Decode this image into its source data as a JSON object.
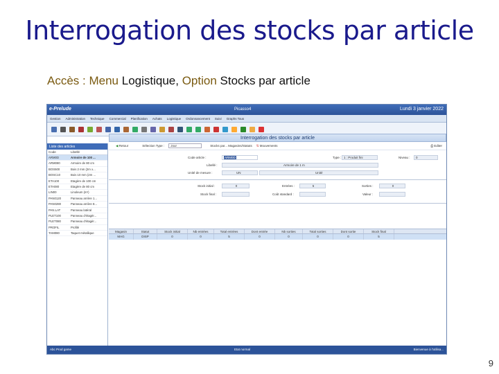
{
  "slide": {
    "title": "Interrogation des stocks par article",
    "sub_k1": "Accès : Menu",
    "sub_v1": "Logistique,",
    "sub_k2": "Option",
    "sub_v2": "Stocks par article",
    "page_number": "9"
  },
  "app": {
    "brand": "e-Prelude",
    "company": "Picasso4",
    "date": "Lundi 3 janvier 2022",
    "menu": [
      "Gestion",
      "Administration",
      "Technique",
      "Commercial",
      "Planification",
      "Achats",
      "Logistique",
      "Ordonnancement",
      "Suivi",
      "Graphs Tous"
    ],
    "toolbar_icons": [
      "disk-icon",
      "print-icon",
      "folder-icon",
      "book-icon",
      "tool-icon",
      "grid-icon",
      "grid-icon",
      "chart-icon",
      "chart-icon",
      "chart-icon",
      "table-icon",
      "grid-icon",
      "envelope-icon",
      "scissors-icon",
      "tools-icon",
      "cart-icon",
      "cart-icon",
      "arrow-icon",
      "stop-icon",
      "refresh-icon",
      "star-icon",
      "gear-icon",
      "warning-icon",
      "delete-icon"
    ],
    "sidebar": {
      "title": "Liste des articles",
      "col1": "Code",
      "col2": "Libellé",
      "rows": [
        {
          "code": "ARM0D",
          "label": "Armoire de 100 ..."
        },
        {
          "code": "ARM080",
          "label": "Armoire de 80 cm"
        },
        {
          "code": "BOS500",
          "label": "Bois 2 mm (2m x..."
        },
        {
          "code": "BOSC10",
          "label": "Bois 10 mm (2m ..."
        },
        {
          "code": "ETA100",
          "label": "Etagère de 100 cm"
        },
        {
          "code": "ETA080",
          "label": "Etagère de 80 cm"
        },
        {
          "code": "LIN00",
          "label": "Linoleum (m²)"
        },
        {
          "code": "PAN0120",
          "label": "Panneau arrière 1..."
        },
        {
          "code": "PAN0280",
          "label": "Panneau arrière 8..."
        },
        {
          "code": "PAN.LAT",
          "label": "Panneau latéral"
        },
        {
          "code": "PLET100",
          "label": "Panneau d'étagèr..."
        },
        {
          "code": "PLET080",
          "label": "Panneau d'étagèr..."
        },
        {
          "code": "PROFIL",
          "label": "Profilé"
        },
        {
          "code": "TAM080",
          "label": "Taquet métallique"
        }
      ]
    },
    "form": {
      "title": "Interrogation des stocks par article",
      "back_label": "Retour",
      "selection_label": "Sélection Type :",
      "selection_value": "Jour",
      "stocks_menu_label": "Stocks par... Magasins/Statuts",
      "movements_label": "Mouvements",
      "edit_label": "Editer",
      "code_label": "Code article :",
      "code_value": "ARM0D",
      "type_label": "Type :",
      "type_value": "1 : Produit fini",
      "niveau_label": "Niveau :",
      "niveau_value": "0",
      "libelle_label": "Libellé :",
      "libelle_value": "Armoire de 1 m",
      "unite_label": "Unité de mesure :",
      "unite_value": "UN",
      "unite_text": "Unité",
      "stock_initial_label": "Stock initial :",
      "stock_initial_value": "0",
      "entrees_label": "Entrées :",
      "entrees_value": "5",
      "sorties_label": "Sorties :",
      "sorties_value": "0",
      "stock_final_label": "Stock final :",
      "cout_label": "Coût standard :",
      "valeur_label": "Valeur :"
    },
    "grid": {
      "headers": [
        "Magasin",
        "Statut",
        "Stock initial",
        "Nb entrées",
        "Total entrées",
        "Dont entrée",
        "Nb sorties",
        "Total sorties",
        "Dont sortie",
        "Stock final"
      ],
      "row": [
        "MAG",
        "DISP",
        "0",
        "0",
        "5",
        "0",
        "0",
        "0",
        "0",
        "5"
      ]
    },
    "status": {
      "left": "Abc  Prod  game",
      "center": "Etat normal",
      "right": "Bienvenue à l'utilisa..."
    }
  }
}
